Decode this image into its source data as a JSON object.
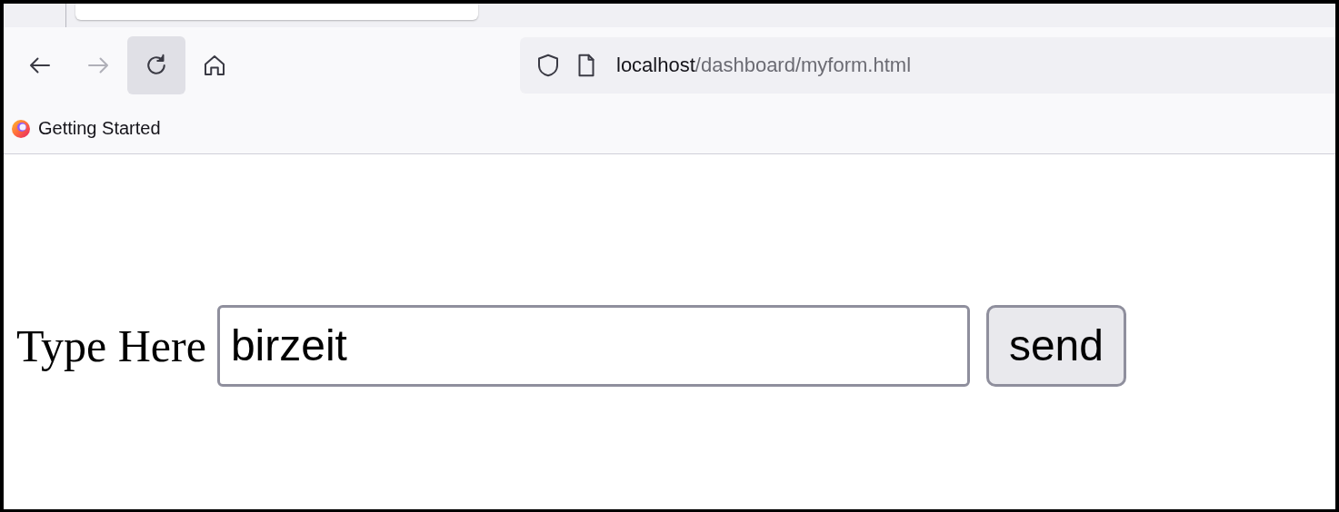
{
  "toolbar": {
    "back": {
      "disabled": false
    },
    "forward": {
      "disabled": true
    },
    "reload": {
      "hovered": true
    }
  },
  "address_bar": {
    "host": "localhost",
    "path": "/dashboard/myform.html"
  },
  "bookmarks": [
    {
      "label": "Getting Started"
    }
  ],
  "form": {
    "label": "Type Here",
    "input_value": "birzeit",
    "button": "send"
  }
}
